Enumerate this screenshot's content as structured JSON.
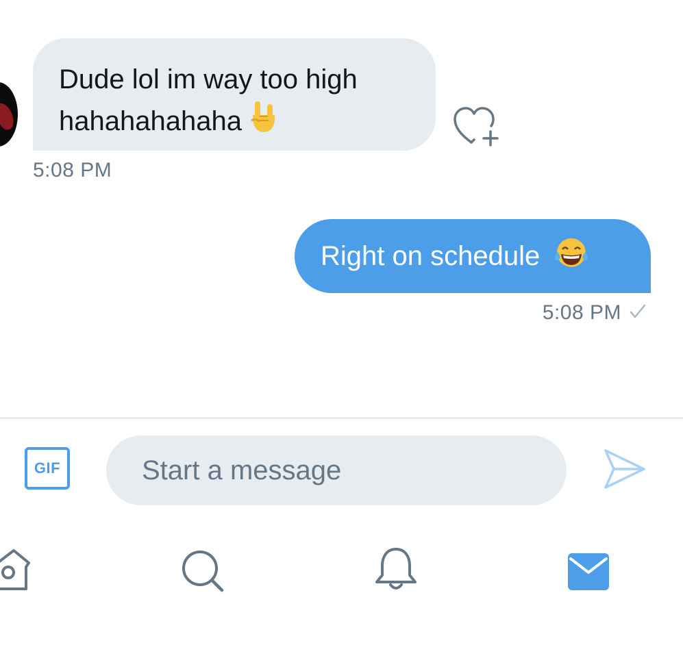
{
  "conversation": {
    "incoming": {
      "lines": [
        "Dude lol im way too high",
        "hahahahahaha"
      ],
      "emoji": "rock-on-hand-emoji",
      "time": "5:08 PM"
    },
    "outgoing": {
      "text": "Right on schedule",
      "emoji": "tears-of-joy-emoji",
      "time": "5:08 PM",
      "status_icon": "checkmark-icon"
    }
  },
  "composer": {
    "gif_label": "GIF",
    "placeholder": "Start a message"
  },
  "tab_bar": {
    "items": [
      "home-icon",
      "search-icon",
      "bell-icon",
      "mail-icon"
    ],
    "active": "mail-icon"
  },
  "colors": {
    "accent": "#4c9ee8",
    "incoming_bubble": "#e6ecf0",
    "muted_text": "#657786",
    "icon_gray": "#657786"
  }
}
